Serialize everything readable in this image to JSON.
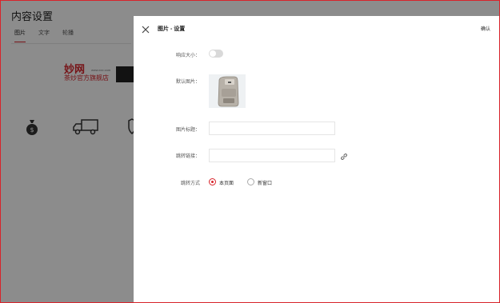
{
  "background": {
    "title": "内容设置",
    "tabs": [
      {
        "label": "图片",
        "active": true
      },
      {
        "label": "文字",
        "active": false
      },
      {
        "label": "轮播",
        "active": false
      }
    ],
    "brand": {
      "line1": "妙网",
      "sub": "www.xxx.com",
      "line2": "茶炒官方旗舰店"
    },
    "icons": [
      "money-bag-icon",
      "delivery-truck-icon",
      "shield-icon"
    ]
  },
  "panel": {
    "title": "图片 - 设置",
    "confirm_label": "确认",
    "fields": {
      "adaptive_size_label": "响应大小：",
      "adaptive_size_on": false,
      "default_image_label": "默认图片：",
      "image_title_label": "图片标题：",
      "image_title_value": "",
      "link_label": "跳转链接：",
      "link_value": "",
      "open_mode_label": "跳转方式",
      "open_mode_options": [
        {
          "label": "本页面",
          "checked": true
        },
        {
          "label": "新窗口",
          "checked": false
        }
      ]
    }
  },
  "colors": {
    "accent": "#d8232a",
    "overlay": "rgba(0,0,0,0.45)"
  }
}
